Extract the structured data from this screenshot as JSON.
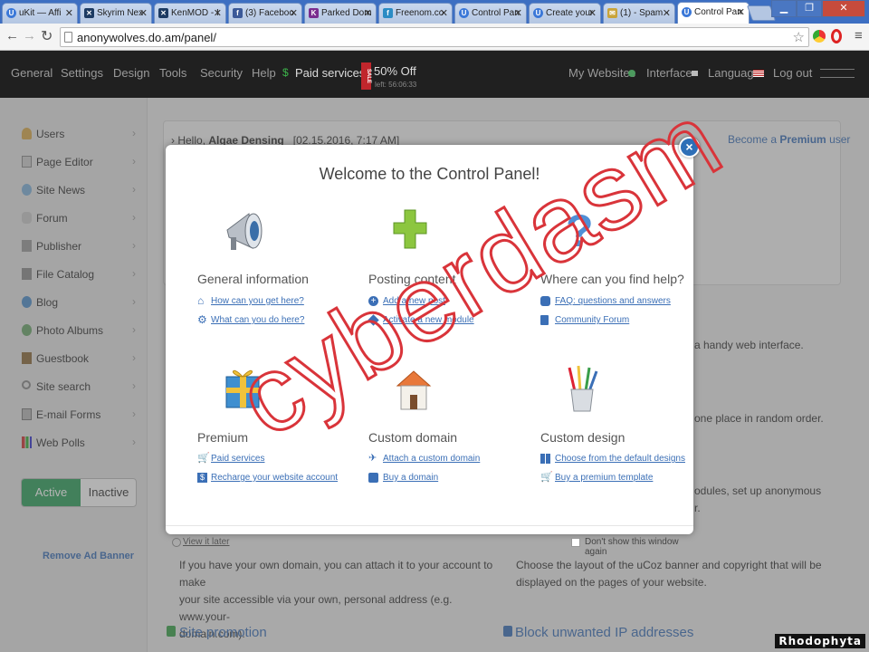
{
  "browser": {
    "tabs": [
      {
        "label": "uKit — Affi",
        "color": "#3b78d8",
        "glyph": "U"
      },
      {
        "label": "Skyrim Nex",
        "color": "#1d3b63",
        "glyph": "✕"
      },
      {
        "label": "KenMOD - I",
        "color": "#1d3b63",
        "glyph": "✕"
      },
      {
        "label": "(3) Faceboo",
        "color": "#3b5998",
        "glyph": "f"
      },
      {
        "label": "Parked Dom",
        "color": "#7a2d8f",
        "glyph": "K"
      },
      {
        "label": "Freenom.co",
        "color": "#2b8cc4",
        "glyph": "f"
      },
      {
        "label": "Control Pan",
        "color": "#3b78d8",
        "glyph": "U"
      },
      {
        "label": "Create your",
        "color": "#3b78d8",
        "glyph": "U"
      },
      {
        "label": "(1) - Spam -",
        "color": "#c9a43a",
        "glyph": "✉"
      },
      {
        "label": "Control Pan",
        "color": "#3b78d8",
        "glyph": "U"
      }
    ],
    "url": "anonywolves.do.am/panel/"
  },
  "topnav": {
    "items": [
      "General",
      "Settings",
      "Design",
      "Tools",
      "Security",
      "Help"
    ],
    "paid": "Paid services",
    "sale_badge": "SALE",
    "discount": "50% Off",
    "timer": "left: 56:06:33",
    "my_websites": "My Websites",
    "interface": "Interface",
    "language": "Language",
    "logout": "Log out"
  },
  "sidebar": {
    "items": [
      "Users",
      "Page Editor",
      "Site News",
      "Forum",
      "Publisher",
      "File Catalog",
      "Blog",
      "Photo Albums",
      "Guestbook",
      "Site search",
      "E-mail Forms",
      "Web Polls"
    ],
    "active": "Active",
    "inactive": "Inactive",
    "remove_banner": "Remove Ad Banner"
  },
  "main": {
    "hello_prefix": "Hello,",
    "user_name": "Algae Densing",
    "date": "[02.15.2016, 7:17 AM]",
    "become_prefix": "Become a",
    "premium": "Premium",
    "user_suffix": "user",
    "frag1": "a handy web interface.",
    "frag2": "one place in random order.",
    "frag3": "odules, set up anonymous",
    "frag4": "r.",
    "domain_text_1": "If you have your own domain, you can attach it to your account to make",
    "domain_text_2": "your site accessible via your own, personal address (e.g. www.your-",
    "domain_text_3": "domain.com).",
    "layout_text_1": "Choose the layout of the uCoz banner and copyright that will be",
    "layout_text_2": "displayed on the pages of your website.",
    "site_promotion": "Site promotion",
    "block_ip": "Block unwanted IP addresses"
  },
  "modal": {
    "title": "Welcome to the Control Panel!",
    "sections": [
      {
        "title": "General information",
        "links": [
          "How can you get here?",
          "What can you do here?"
        ]
      },
      {
        "title": "Posting content",
        "links": [
          "Add a new post",
          "Activate a new module"
        ]
      },
      {
        "title": "Where can you find help?",
        "links": [
          "FAQ: questions and answers",
          "Community Forum"
        ]
      },
      {
        "title": "Premium",
        "links": [
          "Paid services",
          "Recharge your website account"
        ]
      },
      {
        "title": "Custom domain",
        "links": [
          "Attach a custom domain",
          "Buy a domain"
        ]
      },
      {
        "title": "Custom design",
        "links": [
          "Choose from the default designs",
          "Buy a premium template"
        ]
      }
    ],
    "view_later": "View it later",
    "dont_show": "Don't show this window again",
    "close": "×"
  },
  "watermark": "cyberdasm",
  "signature": "Rhodophyta",
  "colors": {
    "accent": "#3b6fb6",
    "active_green": "#2e9e5b",
    "watermark": "#d9343a",
    "nav_bg": "#202020"
  }
}
